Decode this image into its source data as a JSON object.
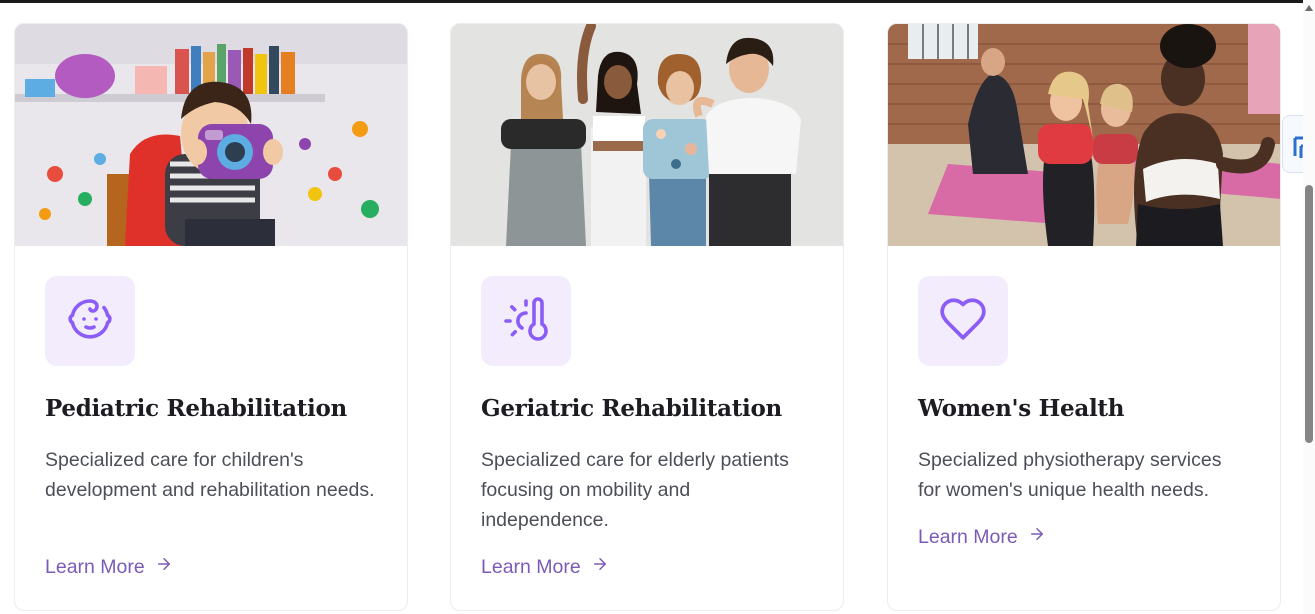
{
  "cards": [
    {
      "title": "Pediatric Rehabilitation",
      "description": "Specialized care for children's development and rehabilitation needs.",
      "link_label": "Learn More",
      "icon": "baby-face-icon",
      "image": "child-with-toy-camera-photo"
    },
    {
      "title": "Geriatric Rehabilitation",
      "description": "Specialized care for elderly patients focusing on mobility and independence.",
      "link_label": "Learn More",
      "icon": "thermometer-sun-icon",
      "image": "group-of-women-laughing-photo"
    },
    {
      "title": "Women's Health",
      "description": "Specialized physiotherapy services for women's unique health needs.",
      "link_label": "Learn More",
      "icon": "heart-icon",
      "image": "women-fitness-class-photo"
    }
  ],
  "colors": {
    "accent": "#7a5bb5",
    "icon_purple": "#8b5cf6",
    "icon_bg": "#f3ecfd",
    "title": "#1c1c22",
    "body_text": "#4c4f57"
  }
}
